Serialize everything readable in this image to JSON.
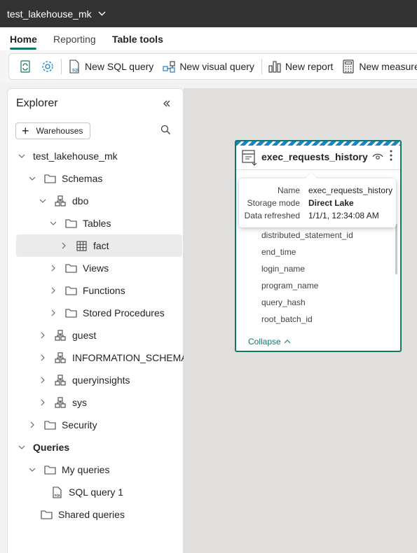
{
  "titlebar": {
    "workspace": "test_lakehouse_mk"
  },
  "tabs": [
    {
      "label": "Home",
      "active": true
    },
    {
      "label": "Reporting",
      "active": false
    },
    {
      "label": "Table tools",
      "active": false
    }
  ],
  "ribbon": {
    "refresh_icon": "refresh-icon",
    "settings_icon": "gear-icon",
    "new_sql_query": "New SQL query",
    "new_visual_query": "New visual query",
    "new_report": "New report",
    "new_measure": "New measure"
  },
  "explorer": {
    "title": "Explorer",
    "warehouses_button": "Warehouses",
    "tree": {
      "root": "test_lakehouse_mk",
      "schemas": "Schemas",
      "dbo": "dbo",
      "tables": "Tables",
      "fact": "fact",
      "views": "Views",
      "functions": "Functions",
      "stored_procedures": "Stored Procedures",
      "guest": "guest",
      "information_schema": "INFORMATION_SCHEMA",
      "queryinsights": "queryinsights",
      "sys": "sys",
      "security": "Security",
      "queries": "Queries",
      "my_queries": "My queries",
      "sql_query_1": "SQL query 1",
      "shared_queries": "Shared queries"
    }
  },
  "card": {
    "title": "exec_requests_history",
    "columns": [
      "distributed_statement_id",
      "end_time",
      "login_name",
      "program_name",
      "query_hash",
      "root_batch_id"
    ],
    "collapse": "Collapse"
  },
  "tooltip": {
    "name_label": "Name",
    "name_value": "exec_requests_history",
    "storage_label": "Storage mode",
    "storage_value": "Direct Lake",
    "refreshed_label": "Data refreshed",
    "refreshed_value": "1/1/1, 12:34:08 AM"
  },
  "colors": {
    "accent": "#117865",
    "titlebar": "#333333",
    "stripe": "#1a84c6"
  }
}
